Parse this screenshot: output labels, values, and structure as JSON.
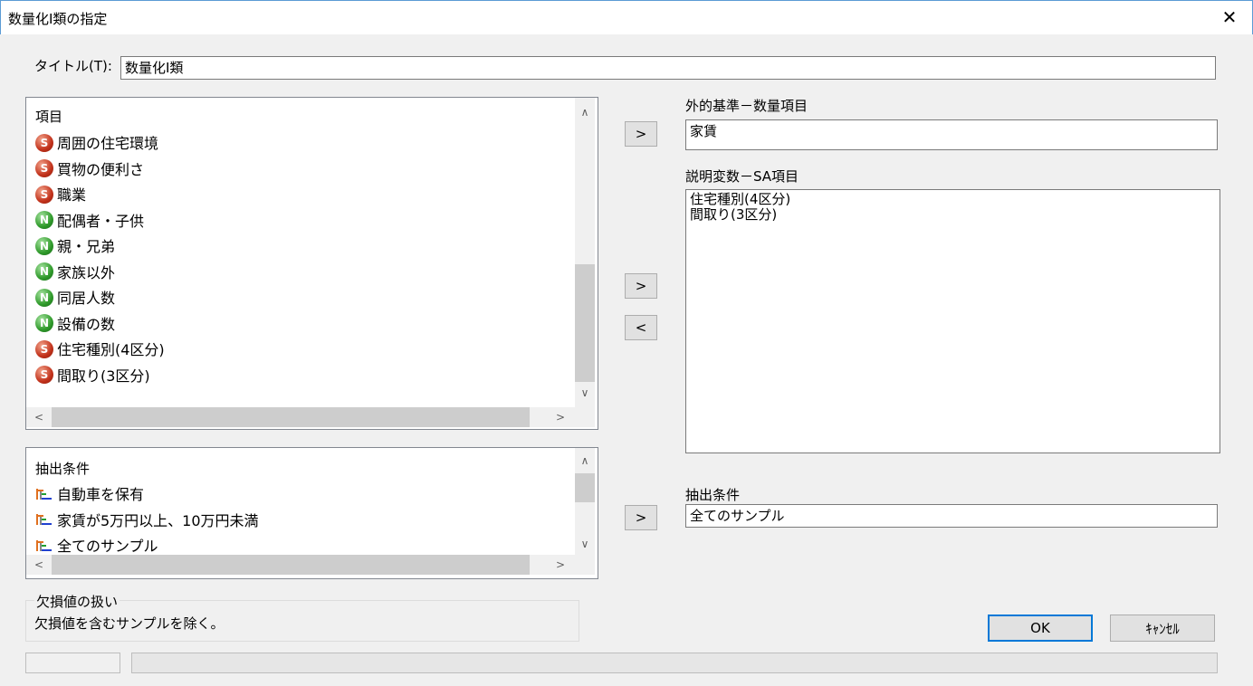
{
  "window": {
    "title": "数量化Ⅰ類の指定",
    "close_glyph": "✕"
  },
  "title_field": {
    "label": "タイトル(T):",
    "value": "数量化Ⅰ類"
  },
  "items_list": {
    "header": "項目",
    "items": [
      {
        "badge": "S",
        "label": "周囲の住宅環境"
      },
      {
        "badge": "S",
        "label": "買物の便利さ"
      },
      {
        "badge": "S",
        "label": "職業"
      },
      {
        "badge": "N",
        "label": "配偶者・子供"
      },
      {
        "badge": "N",
        "label": "親・兄弟"
      },
      {
        "badge": "N",
        "label": "家族以外"
      },
      {
        "badge": "N",
        "label": "同居人数"
      },
      {
        "badge": "N",
        "label": "設備の数"
      },
      {
        "badge": "S",
        "label": "住宅種別(4区分)"
      },
      {
        "badge": "S",
        "label": "間取り(3区分)"
      }
    ]
  },
  "conditions_list": {
    "header": "抽出条件",
    "items": [
      {
        "label": "自動車を保有"
      },
      {
        "label": "家賃が5万円以上、10万円未満"
      },
      {
        "label": "全てのサンプル"
      }
    ]
  },
  "external_criterion": {
    "label": "外的基準－数量項目",
    "value": "家賃"
  },
  "explanatory": {
    "label": "説明変数－SA項目",
    "lines": [
      "住宅種別(4区分)",
      "間取り(3区分)"
    ]
  },
  "extract_condition": {
    "label": "抽出条件",
    "value": "全てのサンプル"
  },
  "missing": {
    "label": "欠損値の扱い",
    "value": "欠損値を含むサンプルを除く。"
  },
  "buttons": {
    "add": ">",
    "remove": "<",
    "ok": "OK",
    "cancel": "ｷｬﾝｾﾙ"
  },
  "scroll": {
    "up": "∧",
    "down": "∨",
    "left": "<",
    "right": ">"
  },
  "colors": {
    "accent": "#0078d7",
    "badge_s": "#c2321b",
    "badge_n": "#2f9a2a"
  }
}
